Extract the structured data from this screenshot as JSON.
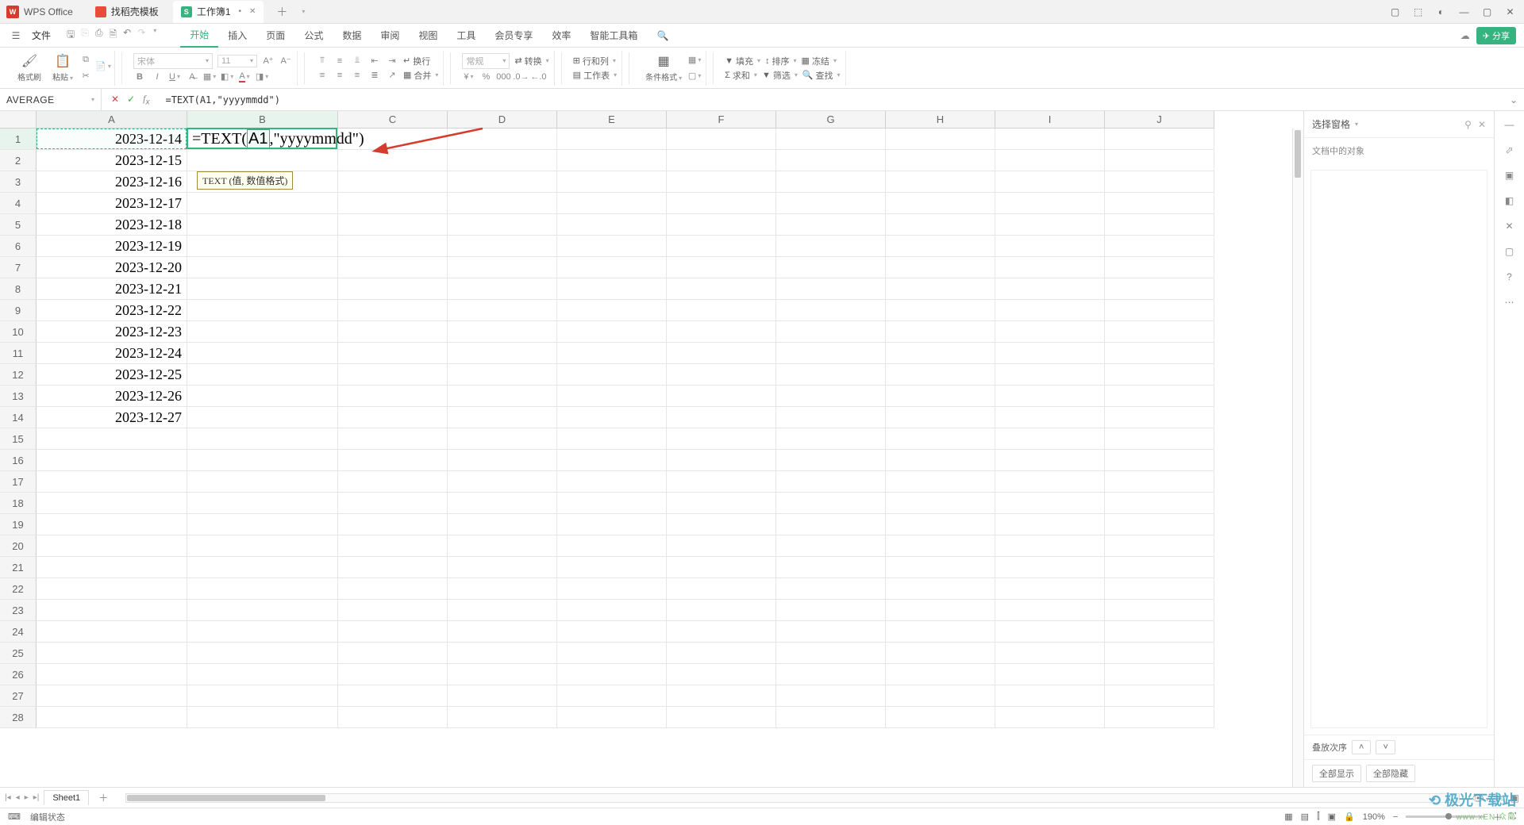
{
  "titlebar": {
    "appName": "WPS Office",
    "tabs": [
      {
        "icon": "red",
        "label": "找稻壳模板"
      },
      {
        "icon": "green",
        "iconText": "S",
        "label": "工作簿1",
        "active": true,
        "dirty": "•"
      }
    ]
  },
  "menubar": {
    "fileLabel": "文件",
    "items": [
      "开始",
      "插入",
      "页面",
      "公式",
      "数据",
      "审阅",
      "视图",
      "工具",
      "会员专享",
      "效率",
      "智能工具箱"
    ],
    "activeIndex": 0,
    "shareLabel": "分享"
  },
  "ribbon": {
    "groups": {
      "clipboard": {
        "formatBrush": "格式刷",
        "paste": "粘贴"
      },
      "font": {
        "fontName": "宋体",
        "fontSize": "11"
      },
      "align": {
        "wrap": "换行",
        "merge": "合并"
      },
      "number": {
        "format": "常规",
        "convert": "转换"
      },
      "table": {
        "rowcol": "行和列",
        "worksheet": "工作表"
      },
      "style": {
        "condFormat": "条件格式"
      },
      "editing": {
        "fill": "填充",
        "sort": "排序",
        "freeze": "冻结",
        "sum": "求和",
        "filter": "筛选",
        "find": "查找"
      }
    }
  },
  "formulaBar": {
    "nameBoxValue": "AVERAGE",
    "formula": "=TEXT(A1,\"yyyymmdd\")"
  },
  "tooltip": {
    "text": "TEXT (值, 数值格式)"
  },
  "grid": {
    "columns": [
      "A",
      "B",
      "C",
      "D",
      "E",
      "F",
      "G",
      "H",
      "I",
      "J"
    ],
    "rowCount": 28,
    "activeCell": "B1",
    "editingFormula": {
      "prefix": "=TEXT(",
      "ref": "A1",
      "suffix": ",\"yyyymmdd\")"
    },
    "colAData": [
      "2023-12-14",
      "2023-12-15",
      "2023-12-16",
      "2023-12-17",
      "2023-12-18",
      "2023-12-19",
      "2023-12-20",
      "2023-12-21",
      "2023-12-22",
      "2023-12-23",
      "2023-12-24",
      "2023-12-25",
      "2023-12-26",
      "2023-12-27"
    ]
  },
  "sheetTabs": {
    "tabs": [
      "Sheet1"
    ]
  },
  "sidePanel": {
    "title": "选择窗格",
    "subtitle": "文档中的对象",
    "stackOrder": "叠放次序",
    "showAll": "全部显示",
    "hideAll": "全部隐藏"
  },
  "statusBar": {
    "mode": "编辑状态",
    "zoom": "190%"
  }
}
